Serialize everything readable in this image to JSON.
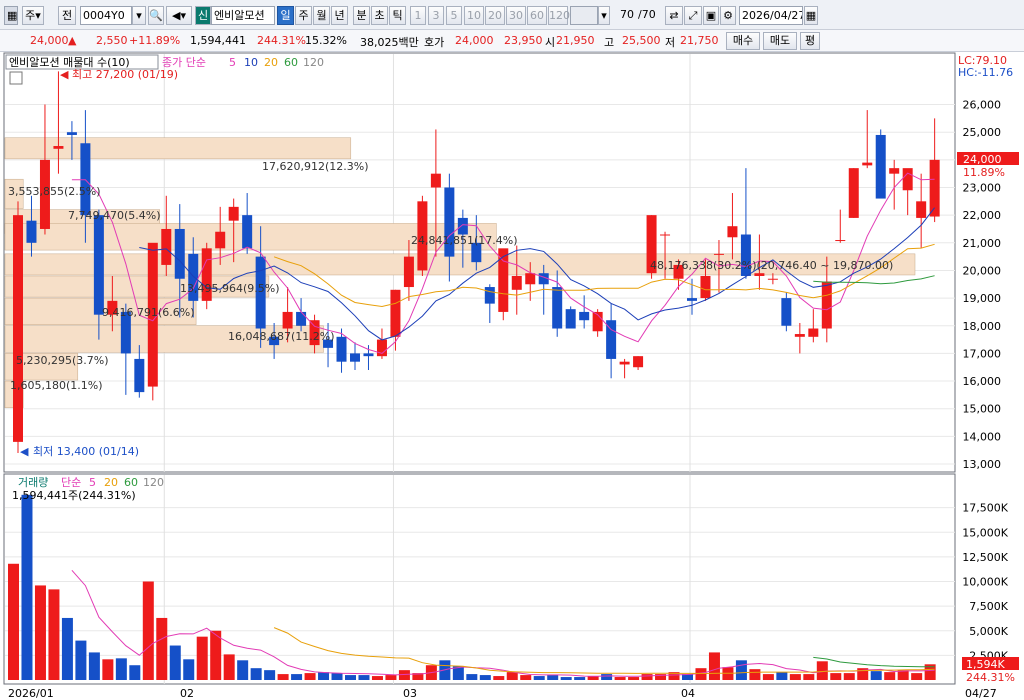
{
  "toolbar": {
    "period": "주",
    "prev": "전",
    "code": "0004Y0",
    "shin": "신",
    "stock_name": "엔비알모션",
    "tf": [
      "일",
      "주",
      "월",
      "년",
      "분",
      "초",
      "틱"
    ],
    "nums": [
      "1",
      "3",
      "5",
      "10",
      "20",
      "30",
      "60",
      "120"
    ],
    "count": "70",
    "count_total": "/70",
    "date": "2026/04/27"
  },
  "quote": {
    "price": "24,000",
    "arrow": "▲",
    "change": "2,550",
    "change_pct": "+11.89%",
    "volume": "1,594,441",
    "volume_ratio": "244.31%",
    "turnover": "15.32%",
    "amount": "38,025백만",
    "hoga_label": "호가",
    "ask": "24,000",
    "bid": "23,950",
    "open_label": "시",
    "open": "21,950",
    "high_label": "고",
    "high": "25,500",
    "low_label": "저",
    "low": "21,750",
    "buy": "매수",
    "sell": "매도",
    "even": "평"
  },
  "price_panel": {
    "title": "엔비알모션 매물대 수(10)",
    "ma_label": "종가 단순",
    "ma_periods": [
      "5",
      "10",
      "20",
      "60",
      "120"
    ],
    "lc": "LC:79.10",
    "hc": "HC:-11.76",
    "high_note": "최고 27,200 (01/19)",
    "low_note": "최저 13,400 (01/14)",
    "current": "24,000",
    "current_pct": "11.89%",
    "y_ticks": [
      "26,000",
      "25,000",
      "24,000",
      "23,000",
      "22,000",
      "21,000",
      "20,000",
      "19,000",
      "18,000",
      "17,000",
      "16,000",
      "15,000",
      "14,000",
      "13,000"
    ],
    "vp_labels": [
      "17,620,912(12.3%)",
      "3,553,855(2.5%)",
      "7,749,470(5.4%)",
      "24,841,851(17.4%)",
      "48,176,338(30.2%)(20,746.40 ~ 19,870.00)",
      "13,495,964(9.5%)",
      "9,416,791(6.6%)",
      "16,048,687(11.2%)",
      "5,230,295(3.7%)",
      "1,605,180(1.1%)"
    ]
  },
  "volume_panel": {
    "title": "거래량",
    "ma_label": "단순",
    "ma_periods": [
      "5",
      "20",
      "60",
      "120"
    ],
    "summary": "1,594,441주(244.31%)",
    "y_ticks": [
      "17,500K",
      "15,000K",
      "12,500K",
      "10,000K",
      "7,500K",
      "5,000K",
      "2,500K"
    ],
    "current": "1,594K",
    "current_pct": "244.31%"
  },
  "x_axis": [
    "2026/01",
    "02",
    "03",
    "04",
    "04/27"
  ],
  "colors": {
    "up": "#ee1b1b",
    "down": "#1550c8",
    "ma5": "#e23bb5",
    "ma10": "#1c3fb8",
    "ma20": "#e8a00b",
    "ma60": "#2e9a3e",
    "vp": "#f6dfc8"
  },
  "chart_data": {
    "type": "candlestick",
    "candles_ohlc": [
      [
        13800,
        22500,
        13400,
        22000
      ],
      [
        21800,
        22700,
        20500,
        21000
      ],
      [
        21500,
        26000,
        21300,
        24000
      ],
      [
        24400,
        27200,
        23500,
        24500
      ],
      [
        25000,
        25400,
        24000,
        24900
      ],
      [
        24600,
        25800,
        21000,
        22000
      ],
      [
        22000,
        22200,
        17500,
        18400
      ],
      [
        18400,
        19800,
        17800,
        18900
      ],
      [
        18500,
        18800,
        15500,
        17000
      ],
      [
        16800,
        17300,
        15400,
        15600
      ],
      [
        15800,
        20600,
        15300,
        21000
      ],
      [
        20200,
        22700,
        19800,
        21500
      ],
      [
        21500,
        22400,
        18300,
        19700
      ],
      [
        20600,
        21200,
        18300,
        18900
      ],
      [
        18900,
        21000,
        18600,
        20800
      ],
      [
        20800,
        22300,
        20200,
        21400
      ],
      [
        21800,
        22600,
        20300,
        22300
      ],
      [
        22000,
        22800,
        20600,
        20800
      ],
      [
        20500,
        21600,
        17200,
        17900
      ],
      [
        17600,
        18100,
        16800,
        17300
      ],
      [
        17900,
        19400,
        17400,
        18500
      ],
      [
        18500,
        19000,
        17800,
        18000
      ],
      [
        17300,
        18400,
        17000,
        18200
      ],
      [
        17500,
        18100,
        16500,
        17200
      ],
      [
        17600,
        17900,
        16300,
        16700
      ],
      [
        17000,
        17400,
        16400,
        16700
      ],
      [
        17000,
        17300,
        16400,
        16900
      ],
      [
        16900,
        17900,
        16800,
        17500
      ],
      [
        17600,
        19300,
        17100,
        19300
      ],
      [
        19400,
        21100,
        18900,
        20500
      ],
      [
        20000,
        22700,
        19800,
        22500
      ],
      [
        23000,
        25100,
        20500,
        23500
      ],
      [
        23000,
        23500,
        19600,
        20500
      ],
      [
        21900,
        22200,
        20100,
        21300
      ],
      [
        21000,
        22000,
        20000,
        20300
      ],
      [
        19400,
        19500,
        18100,
        18800
      ],
      [
        18500,
        20700,
        18200,
        20800
      ],
      [
        19300,
        20900,
        18400,
        19800
      ],
      [
        19500,
        20300,
        18900,
        19900
      ],
      [
        19900,
        20200,
        18400,
        19500
      ],
      [
        19400,
        20000,
        17600,
        17900
      ],
      [
        18600,
        18700,
        18400,
        17900
      ],
      [
        18500,
        19100,
        17900,
        18200
      ],
      [
        17800,
        18600,
        17600,
        18500
      ],
      [
        18200,
        18800,
        16100,
        16800
      ],
      [
        16600,
        16800,
        16100,
        16700
      ],
      [
        16500,
        16900,
        16400,
        16900
      ],
      [
        19900,
        22000,
        19700,
        22000
      ],
      [
        21300,
        21400,
        19700,
        21300
      ],
      [
        19700,
        20400,
        19300,
        20200
      ],
      [
        19000,
        19700,
        18400,
        18900
      ],
      [
        19000,
        20400,
        18900,
        19800
      ],
      [
        20600,
        21100,
        19200,
        20600
      ],
      [
        21200,
        22800,
        20400,
        21600
      ],
      [
        21300,
        23700,
        19700,
        19800
      ],
      [
        19800,
        21300,
        19300,
        19900
      ],
      [
        19700,
        19900,
        19500,
        19700
      ],
      [
        19000,
        19200,
        17800,
        18000
      ],
      [
        17600,
        18100,
        17000,
        17700
      ],
      [
        17600,
        18600,
        17400,
        17900
      ],
      [
        17900,
        20500,
        17400,
        19600
      ],
      [
        21100,
        22200,
        21000,
        21100
      ],
      [
        21900,
        23700,
        21900,
        23700
      ],
      [
        23800,
        25800,
        23700,
        23900
      ],
      [
        24900,
        25100,
        22800,
        22600
      ],
      [
        23500,
        24000,
        22200,
        23700
      ],
      [
        22900,
        23300,
        22000,
        23700
      ],
      [
        21900,
        23500,
        20800,
        22500
      ],
      [
        21950,
        25500,
        21750,
        24000
      ]
    ],
    "volume_k": [
      11800,
      18800,
      9600,
      9200,
      6300,
      4000,
      2800,
      2100,
      2200,
      1500,
      10000,
      6300,
      3500,
      2100,
      4400,
      5000,
      2600,
      2000,
      1200,
      1000,
      600,
      600,
      700,
      800,
      700,
      500,
      500,
      400,
      500,
      1000,
      700,
      1500,
      2000,
      1400,
      600,
      500,
      400,
      800,
      500,
      400,
      500,
      300,
      300,
      400,
      600,
      300,
      300,
      600,
      600,
      800,
      600,
      1200,
      2800,
      1300,
      2000,
      1100,
      600,
      800,
      600,
      600,
      1900,
      700,
      700,
      1200,
      900,
      800,
      1000,
      700,
      1594
    ]
  }
}
